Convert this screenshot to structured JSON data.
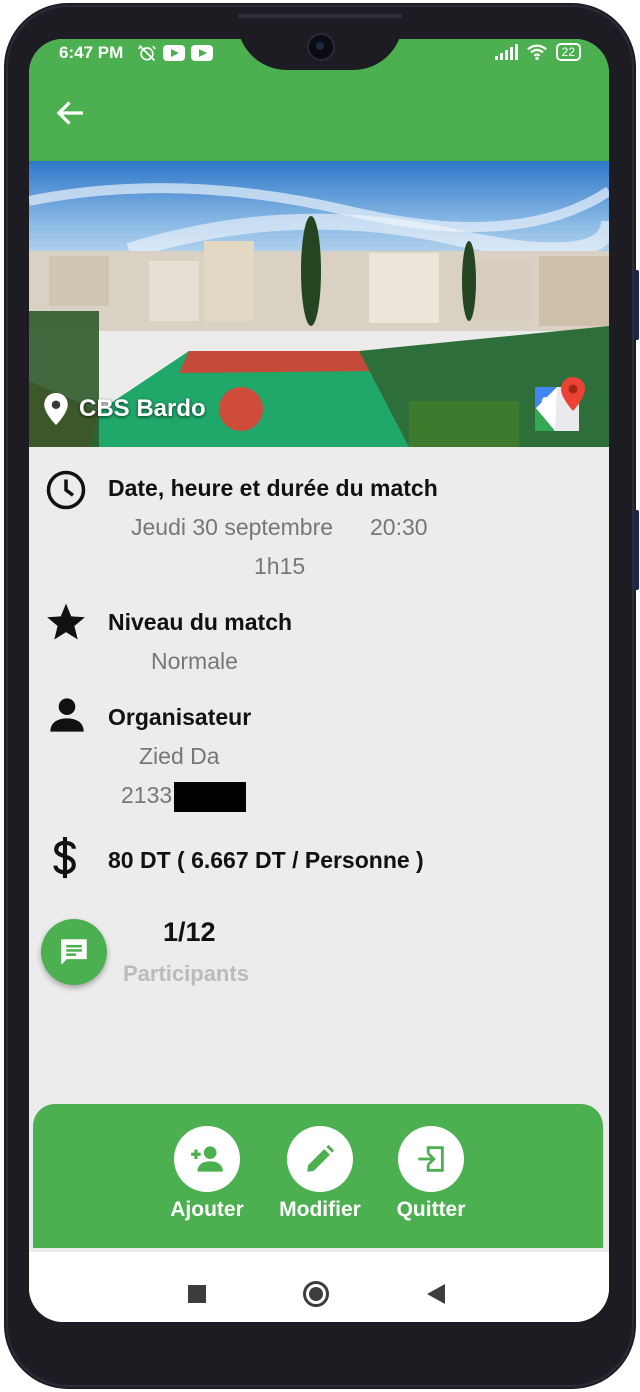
{
  "status_bar": {
    "time": "6:47 PM",
    "battery": "22",
    "icons": [
      "alarm-off-icon",
      "youtube-icon",
      "youtube-icon",
      "signal-icon",
      "wifi-icon",
      "battery-icon"
    ]
  },
  "app_bar": {
    "back_icon": "arrow-back-icon"
  },
  "hero": {
    "location_name": "CBS Bardo",
    "location_icon": "map-pin-icon",
    "maps_icon": "google-maps-icon"
  },
  "details": {
    "date_section": {
      "icon": "clock-icon",
      "title": "Date, heure et durée du match",
      "date": "Jeudi 30 septembre",
      "time": "20:30",
      "duration": "1h15"
    },
    "level_section": {
      "icon": "star-icon",
      "title": "Niveau du match",
      "value": "Normale"
    },
    "organizer_section": {
      "icon": "person-icon",
      "title": "Organisateur",
      "name": "Zied Da",
      "phone": "2133"
    },
    "price_section": {
      "icon": "dollar-icon",
      "text": "80 DT ( 6.667 DT / Personne )"
    }
  },
  "participants": {
    "count": "1/12",
    "label": "Participants",
    "chat_icon": "chat-icon"
  },
  "actions": [
    {
      "label": "Ajouter",
      "icon": "add-person-icon"
    },
    {
      "label": "Modifier",
      "icon": "edit-pencil-icon"
    },
    {
      "label": "Quitter",
      "icon": "exit-icon"
    }
  ],
  "colors": {
    "primary_green": "#4caf50",
    "background": "#ececec",
    "secondary_text": "#777777"
  }
}
